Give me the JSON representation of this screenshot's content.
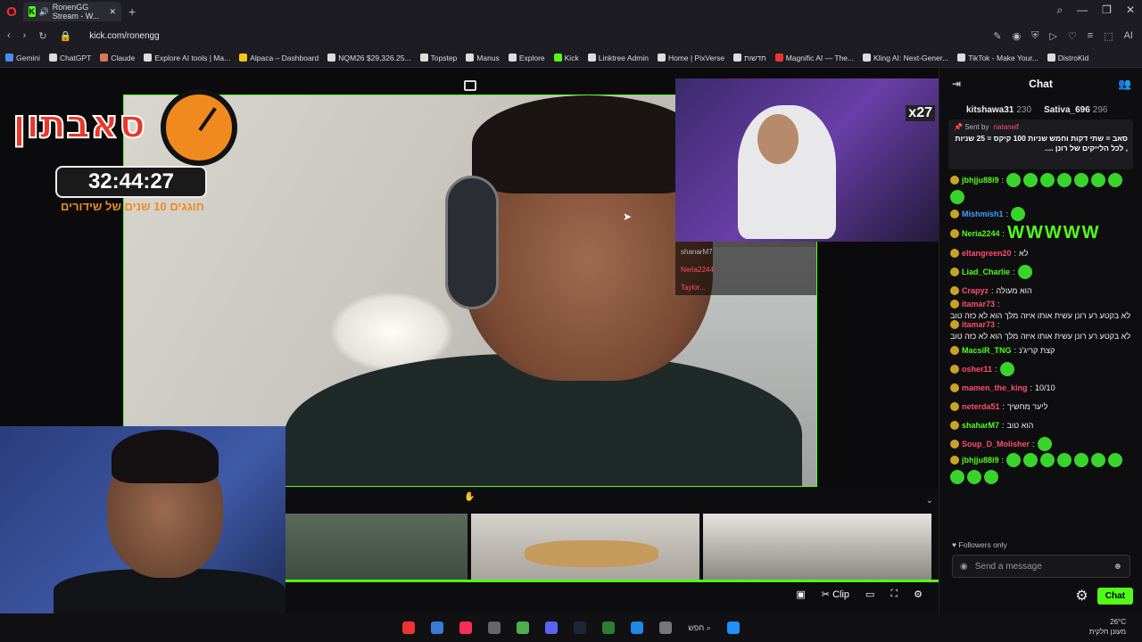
{
  "browser": {
    "tab_title": "RonenGG Stream - W...",
    "url": "kick.com/ronengg",
    "bookmarks": [
      {
        "label": "Gemini",
        "color": "#4a8cf7"
      },
      {
        "label": "ChatGPT",
        "color": "#ddd"
      },
      {
        "label": "Claude",
        "color": "#d97757"
      },
      {
        "label": "Explore AI tools | Ma...",
        "color": "#ddd"
      },
      {
        "label": "Alpaca – Dashboard",
        "color": "#f5c518"
      },
      {
        "label": "NQM26 $29,326.25...",
        "color": "#ddd"
      },
      {
        "label": "Topstep",
        "color": "#ddd"
      },
      {
        "label": "Manus",
        "color": "#ddd"
      },
      {
        "label": "Explore",
        "color": "#ddd"
      },
      {
        "label": "Kick",
        "color": "#53fc18"
      },
      {
        "label": "Linktree Admin",
        "color": "#ddd"
      },
      {
        "label": "Home | PixVerse",
        "color": "#ddd"
      },
      {
        "label": "חדשות",
        "color": "#ddd"
      },
      {
        "label": "Magnific AI — The...",
        "color": "#e33"
      },
      {
        "label": "Kling AI: Next-Gener...",
        "color": "#ddd"
      },
      {
        "label": "TikTok - Make Your...",
        "color": "#ddd"
      },
      {
        "label": "DistroKid",
        "color": "#ddd"
      }
    ]
  },
  "overlay": {
    "title": "סאבתון",
    "timer": "32:44:27",
    "subtitle": "חוגגים 10 שנים של שידורים",
    "cam_badge": "x27"
  },
  "mini_chat": [
    "shanarM7",
    "Neria2244",
    "Taylor..."
  ],
  "player": {
    "clip_label": "Clip"
  },
  "chat": {
    "title": "Chat",
    "leaders": [
      {
        "name": "kitshawa31",
        "count": "230"
      },
      {
        "name": "Sativa_696",
        "count": "296"
      }
    ],
    "pinned": {
      "sent_by": "Sent by",
      "sender": "natanelf",
      "message": "סאב = שתי דקות וחמש שניות 100 קיקס = 25 שניות , לכל הלייקים של רונן ...."
    },
    "messages": [
      {
        "user": "jbhjju88i9",
        "color": "#53fc18",
        "text": "",
        "emotes": 8
      },
      {
        "user": "Mishmish1",
        "color": "#3aa0ff",
        "text": "",
        "emotes": 1
      },
      {
        "user": "Neria2244",
        "color": "#53fc18",
        "text": "WWWWW",
        "emotes": 0,
        "big": true
      },
      {
        "user": "eltangreen20",
        "color": "#ff4d6a",
        "text": "לא",
        "emotes": 0
      },
      {
        "user": "Liad_Charlie",
        "color": "#53fc18",
        "text": "",
        "emotes": 1
      },
      {
        "user": "Crapyz",
        "color": "#ff4d6a",
        "text": "הוא מעולה",
        "emotes": 0
      },
      {
        "user": "itamar73",
        "color": "#ff4d6a",
        "text": "לא בקטע רע רונן עשית אותו איזה מלך הוא לא כזה טוב",
        "emotes": 0
      },
      {
        "user": "itamar73",
        "color": "#ff4d6a",
        "text": "לא בקטע רע רונן עשית אותו איזה מלך הוא לא כזה טוב",
        "emotes": 0
      },
      {
        "user": "MacsiR_TNG",
        "color": "#53fc18",
        "text": "קצת קריג'נ",
        "emotes": 0
      },
      {
        "user": "osher11",
        "color": "#ff4d6a",
        "text": "",
        "emotes": 1
      },
      {
        "user": "mamen_the_king",
        "color": "#ff4d6a",
        "text": "10/10",
        "emotes": 0
      },
      {
        "user": "neterda51",
        "color": "#ff4d6a",
        "text": "ליער מחשיך",
        "emotes": 0
      },
      {
        "user": "shaharM7",
        "color": "#53fc18",
        "text": "הוא טוב",
        "emotes": 0
      },
      {
        "user": "Soup_D_Molisher",
        "color": "#ff4d6a",
        "text": "",
        "emotes": 1
      },
      {
        "user": "jbhjju88i9",
        "color": "#53fc18",
        "text": "",
        "emotes": 10
      }
    ],
    "followers_only": "Followers only",
    "input_placeholder": "Send a message",
    "send_label": "Chat"
  },
  "taskbar": {
    "search": "חפש",
    "temp": "26°C",
    "weather": "מעונן חלקית"
  }
}
